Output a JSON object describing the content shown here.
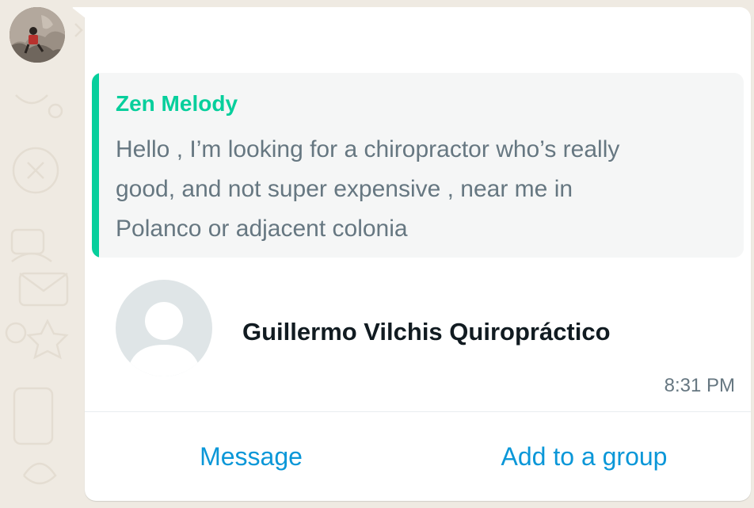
{
  "quoted_message": {
    "author": "Zen Melody",
    "text": "Hello , I’m looking for a chiropractor who’s really good, and not super expensive , near me in Polanco or adjacent colonia",
    "accent_color": "#06cf9c"
  },
  "contact_card": {
    "name": "Guillermo Vilchis Quiropráctico",
    "timestamp": "8:31 PM"
  },
  "actions": {
    "message_label": "Message",
    "add_to_group_label": "Add to a group",
    "link_color": "#0a97d8"
  },
  "icons": {
    "sender_avatar": "profile-photo",
    "contact_avatar": "default-person-icon"
  }
}
